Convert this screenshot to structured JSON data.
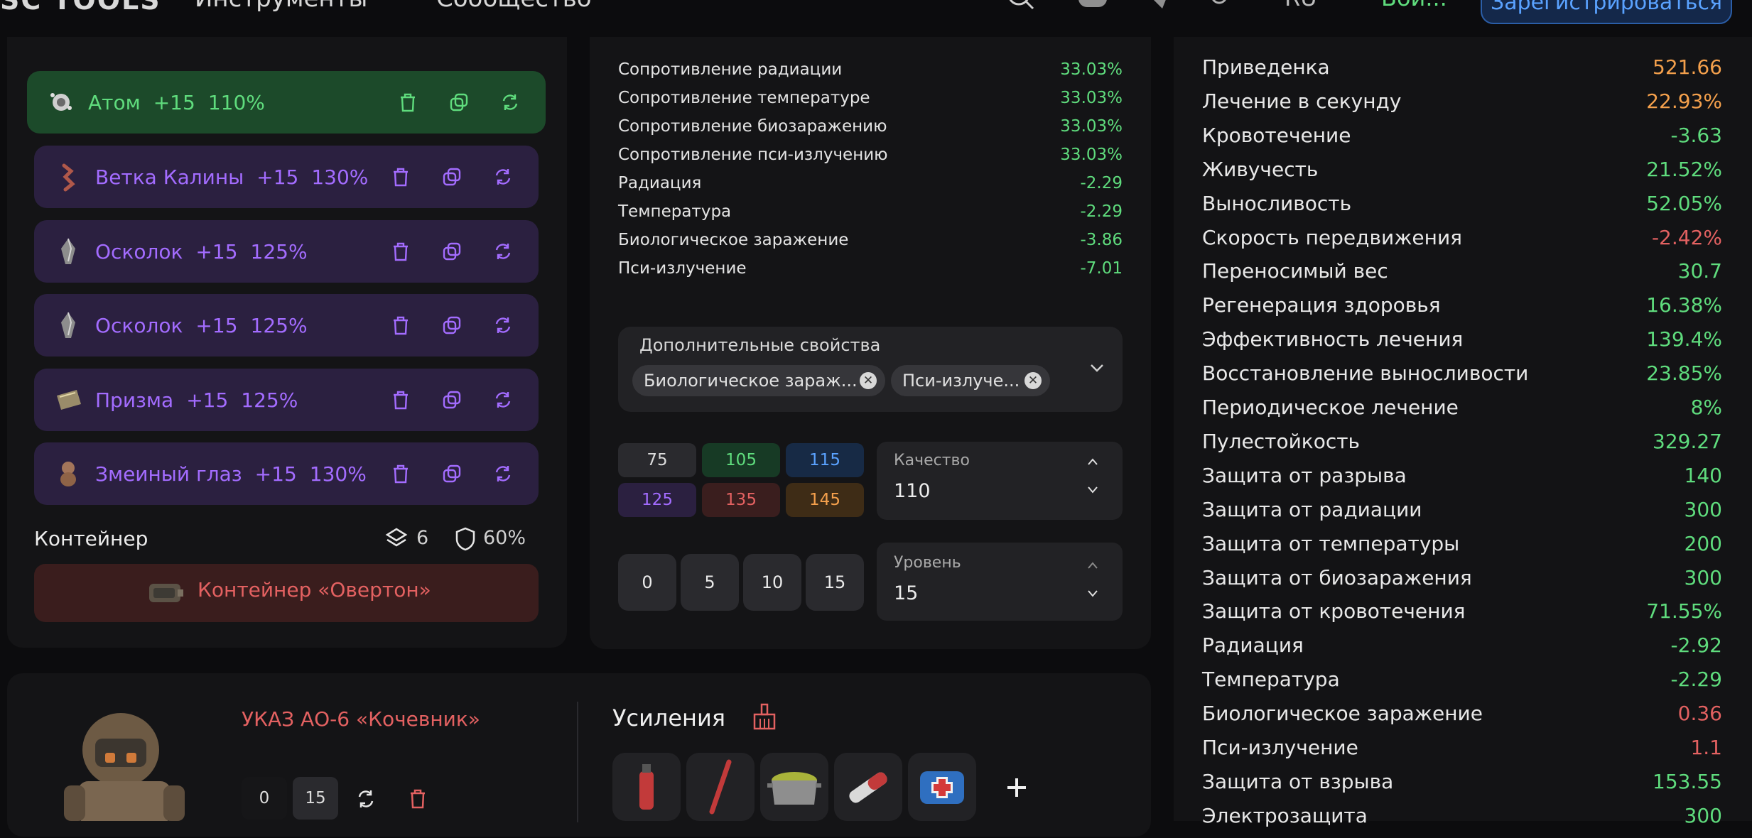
{
  "topbar": {
    "logo": "SC TOOLS",
    "nav": [
      "Инструменты",
      "Сообщество"
    ],
    "lang": "RU",
    "balance": "Вой...",
    "register_label": "Зарегистрироваться"
  },
  "artifacts": [
    {
      "name": "Атом",
      "level": "+15",
      "percent": "110%",
      "selected": true,
      "icon": "atom-icon"
    },
    {
      "name": "Ветка Калины",
      "level": "+15",
      "percent": "130%",
      "selected": false,
      "icon": "viburnum-branch-icon"
    },
    {
      "name": "Осколок",
      "level": "+15",
      "percent": "125%",
      "selected": false,
      "icon": "shard-icon"
    },
    {
      "name": "Осколок",
      "level": "+15",
      "percent": "125%",
      "selected": false,
      "icon": "shard-icon"
    },
    {
      "name": "Призма",
      "level": "+15",
      "percent": "125%",
      "selected": false,
      "icon": "prism-icon"
    },
    {
      "name": "Змеиный глаз",
      "level": "+15",
      "percent": "130%",
      "selected": false,
      "icon": "snake-eye-icon"
    }
  ],
  "container": {
    "label": "Контейнер",
    "slots": "6",
    "protection": "60%",
    "name": "Контейнер «Овертон»"
  },
  "middle_stats": [
    {
      "label": "Сопротивление радиации",
      "value": "33.03%",
      "color": "#5fdc7d"
    },
    {
      "label": "Сопротивление температуре",
      "value": "33.03%",
      "color": "#5fdc7d"
    },
    {
      "label": "Сопротивление биозаражению",
      "value": "33.03%",
      "color": "#5fdc7d"
    },
    {
      "label": "Сопротивление пси-излучению",
      "value": "33.03%",
      "color": "#5fdc7d"
    },
    {
      "label": "Радиация",
      "value": "-2.29",
      "color": "#5fdc7d"
    },
    {
      "label": "Температура",
      "value": "-2.29",
      "color": "#5fdc7d"
    },
    {
      "label": "Биологическое заражение",
      "value": "-3.86",
      "color": "#5fdc7d"
    },
    {
      "label": "Пси-излучение",
      "value": "-7.01",
      "color": "#5fdc7d"
    }
  ],
  "extra_props": {
    "label": "Дополнительные свойства",
    "chips": [
      "Биологическое зараж...",
      "Пси-излуче..."
    ]
  },
  "quality": {
    "buttons": [
      {
        "value": "75",
        "bg": "#2a2a2e",
        "fg": "#dcdcdc"
      },
      {
        "value": "105",
        "bg": "#173a25",
        "fg": "#5fdc7d"
      },
      {
        "value": "115",
        "bg": "#172a45",
        "fg": "#5aa2ff"
      },
      {
        "value": "125",
        "bg": "#2b2040",
        "fg": "#a36cff"
      },
      {
        "value": "135",
        "bg": "#3a1e1e",
        "fg": "#e36161"
      },
      {
        "value": "145",
        "bg": "#3e2c16",
        "fg": "#f4a04c"
      }
    ],
    "label": "Качество",
    "value": "110"
  },
  "level": {
    "buttons": [
      "0",
      "5",
      "10",
      "15"
    ],
    "label": "Уровень",
    "value": "15"
  },
  "armor": {
    "name": "УКАЗ АО-6 «Кочевник»",
    "levels": [
      "0",
      "15"
    ]
  },
  "boosts": {
    "title": "Усиления",
    "items": [
      "fire-extinguisher-icon",
      "syringe-icon",
      "pot-icon",
      "injector-icon",
      "medkit-icon"
    ]
  },
  "right_stats": [
    {
      "label": "Приведенка",
      "value": "521.66",
      "color": "#f4a04c"
    },
    {
      "label": "Лечение в секунду",
      "value": "22.93%",
      "color": "#f4a04c"
    },
    {
      "label": "Кровотечение",
      "value": "-3.63",
      "color": "#5fdc7d"
    },
    {
      "label": "Живучесть",
      "value": "21.52%",
      "color": "#5fdc7d"
    },
    {
      "label": "Выносливость",
      "value": "52.05%",
      "color": "#5fdc7d"
    },
    {
      "label": "Скорость передвижения",
      "value": "-2.42%",
      "color": "#e36161"
    },
    {
      "label": "Переносимый вес",
      "value": "30.7",
      "color": "#5fdc7d"
    },
    {
      "label": "Регенерация здоровья",
      "value": "16.38%",
      "color": "#5fdc7d"
    },
    {
      "label": "Эффективность лечения",
      "value": "139.4%",
      "color": "#5fdc7d"
    },
    {
      "label": "Восстановление выносливости",
      "value": "23.85%",
      "color": "#5fdc7d"
    },
    {
      "label": "Периодическое лечение",
      "value": "8%",
      "color": "#5fdc7d"
    },
    {
      "label": "Пулестойкость",
      "value": "329.27",
      "color": "#5fdc7d"
    },
    {
      "label": "Защита от разрыва",
      "value": "140",
      "color": "#5fdc7d"
    },
    {
      "label": "Защита от радиации",
      "value": "300",
      "color": "#5fdc7d"
    },
    {
      "label": "Защита от температуры",
      "value": "200",
      "color": "#5fdc7d"
    },
    {
      "label": "Защита от биозаражения",
      "value": "300",
      "color": "#5fdc7d"
    },
    {
      "label": "Защита от кровотечения",
      "value": "71.55%",
      "color": "#5fdc7d"
    },
    {
      "label": "Радиация",
      "value": "-2.92",
      "color": "#5fdc7d"
    },
    {
      "label": "Температура",
      "value": "-2.29",
      "color": "#5fdc7d"
    },
    {
      "label": "Биологическое заражение",
      "value": "0.36",
      "color": "#e36161"
    },
    {
      "label": "Пси-излучение",
      "value": "1.1",
      "color": "#e36161"
    },
    {
      "label": "Защита от взрыва",
      "value": "153.55",
      "color": "#5fdc7d"
    },
    {
      "label": "Электрозащита",
      "value": "300",
      "color": "#5fdc7d"
    }
  ]
}
